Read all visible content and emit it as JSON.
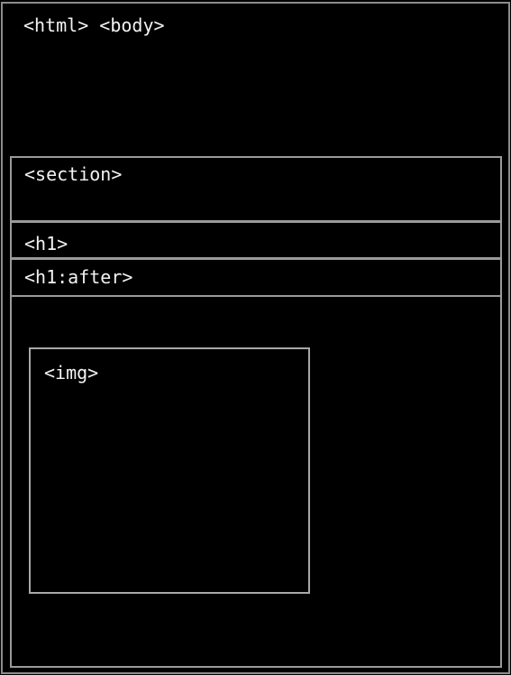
{
  "labels": {
    "html_body": "<html> <body>",
    "section": "<section>",
    "h1": "<h1>",
    "h1_after": "<h1:after>",
    "img": "<img>"
  },
  "colors": {
    "background": "#000000",
    "border": "#9a9a9a",
    "text": "#f2f2f2"
  }
}
